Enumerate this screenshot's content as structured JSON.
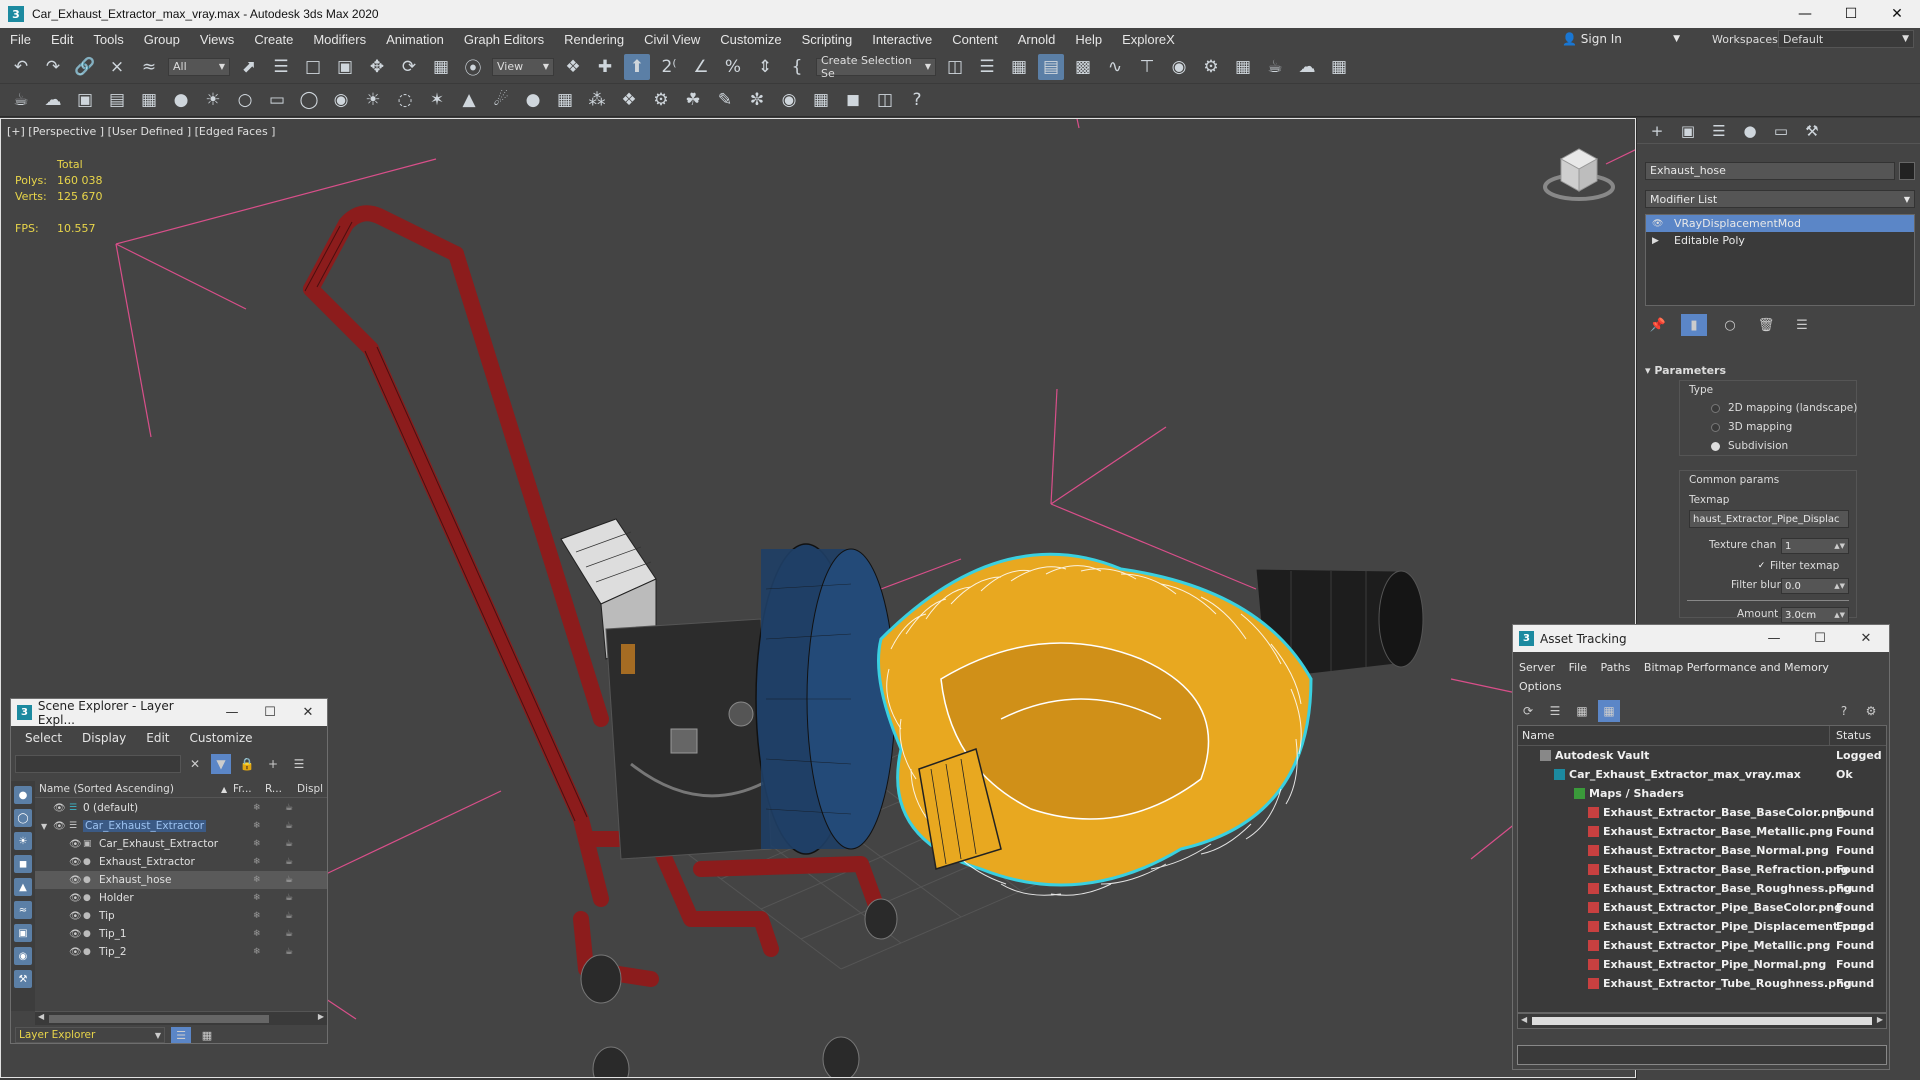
{
  "window": {
    "title": "Car_Exhaust_Extractor_max_vray.max - Autodesk 3ds Max 2020",
    "app_icon_glyph": "3"
  },
  "menu": [
    "File",
    "Edit",
    "Tools",
    "Group",
    "Views",
    "Create",
    "Modifiers",
    "Animation",
    "Graph Editors",
    "Rendering",
    "Civil View",
    "Customize",
    "Scripting",
    "Interactive",
    "Content",
    "Arnold",
    "Help",
    "ExploreX"
  ],
  "signin": {
    "label": "Sign In"
  },
  "workspace": {
    "label": "Workspaces:",
    "value": "Default"
  },
  "toolbar": {
    "filter_value": "All",
    "refcoord_value": "View",
    "selection_set_placeholder": "Create Selection Se"
  },
  "viewport": {
    "label": "[+] [Perspective ] [User Defined ] [Edged Faces ]",
    "stats": {
      "total_label": "Total",
      "polys_label": "Polys:",
      "polys_value": "160 038",
      "verts_label": "Verts:",
      "verts_value": "125 670",
      "fps_label": "FPS:",
      "fps_value": "10.557"
    }
  },
  "command_panel": {
    "object_name": "Exhaust_hose",
    "modifier_list_label": "Modifier List",
    "stack": [
      "VRayDisplacementMod",
      "Editable Poly"
    ],
    "parameters": {
      "header": "Parameters",
      "type_label": "Type",
      "type_options": [
        "2D mapping (landscape)",
        "3D mapping",
        "Subdivision"
      ],
      "type_selected": 2,
      "common_label": "Common params",
      "texmap_label": "Texmap",
      "texmap_value": "haust_Extractor_Pipe_Displac",
      "texture_chan_label": "Texture chan",
      "texture_chan_value": "1",
      "filter_texmap_label": "Filter texmap",
      "filter_blur_label": "Filter blur",
      "filter_blur_value": "0.0",
      "amount_label": "Amount",
      "amount_value": "3.0cm"
    }
  },
  "scene_explorer": {
    "title": "Scene Explorer - Layer Expl...",
    "menu": [
      "Select",
      "Display",
      "Edit",
      "Customize"
    ],
    "columns": [
      "Name (Sorted Ascending)",
      "Fr...",
      "R...",
      "Displ"
    ],
    "rows": [
      {
        "name": "0 (default)",
        "indent": 0
      },
      {
        "name": "Car_Exhaust_Extractor",
        "indent": 0
      },
      {
        "name": "Car_Exhaust_Extractor",
        "indent": 1
      },
      {
        "name": "Exhaust_Extractor",
        "indent": 1
      },
      {
        "name": "Exhaust_hose",
        "indent": 1
      },
      {
        "name": "Holder",
        "indent": 1
      },
      {
        "name": "Tip",
        "indent": 1
      },
      {
        "name": "Tip_1",
        "indent": 1
      },
      {
        "name": "Tip_2",
        "indent": 1
      }
    ],
    "footer_label": "Layer Explorer"
  },
  "asset_tracking": {
    "title": "Asset Tracking",
    "menu": [
      "Server",
      "File",
      "Paths",
      "Bitmap Performance and Memory",
      "Options"
    ],
    "columns": [
      "Name",
      "Status"
    ],
    "rows": [
      {
        "name": "Autodesk Vault",
        "status": "Logged O",
        "level": 0
      },
      {
        "name": "Car_Exhaust_Extractor_max_vray.max",
        "status": "Ok",
        "level": 1
      },
      {
        "name": "Maps / Shaders",
        "status": "",
        "level": 2
      },
      {
        "name": "Exhaust_Extractor_Base_BaseColor.png",
        "status": "Found",
        "level": 3
      },
      {
        "name": "Exhaust_Extractor_Base_Metallic.png",
        "status": "Found",
        "level": 3
      },
      {
        "name": "Exhaust_Extractor_Base_Normal.png",
        "status": "Found",
        "level": 3
      },
      {
        "name": "Exhaust_Extractor_Base_Refraction.png",
        "status": "Found",
        "level": 3
      },
      {
        "name": "Exhaust_Extractor_Base_Roughness.png",
        "status": "Found",
        "level": 3
      },
      {
        "name": "Exhaust_Extractor_Pipe_BaseColor.png",
        "status": "Found",
        "level": 3
      },
      {
        "name": "Exhaust_Extractor_Pipe_Displacement.png",
        "status": "Found",
        "level": 3
      },
      {
        "name": "Exhaust_Extractor_Pipe_Metallic.png",
        "status": "Found",
        "level": 3
      },
      {
        "name": "Exhaust_Extractor_Pipe_Normal.png",
        "status": "Found",
        "level": 3
      },
      {
        "name": "Exhaust_Extractor_Tube_Roughness.png",
        "status": "Found",
        "level": 3
      }
    ]
  },
  "colors": {
    "selection_blue": "#5b86c7",
    "stats_yellow": "#e8d54a",
    "hose_yellow": "#e8a820",
    "frame_red": "#8c1c1c",
    "fan_blue": "#1f3f66"
  }
}
